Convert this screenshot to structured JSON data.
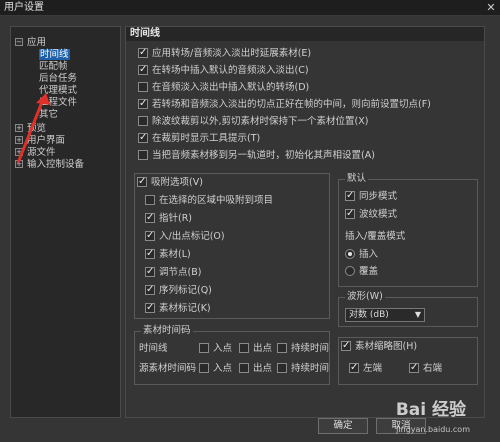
{
  "window": {
    "title": "用户设置",
    "close_glyph": "✕"
  },
  "tree": {
    "items": [
      {
        "label": "应用",
        "expander": "−",
        "level": 0
      },
      {
        "label": "时间线",
        "level": 1,
        "selected": true
      },
      {
        "label": "匹配帧",
        "level": 1
      },
      {
        "label": "后台任务",
        "level": 1
      },
      {
        "label": "代理模式",
        "level": 1
      },
      {
        "label": "工程文件",
        "level": 1
      },
      {
        "label": "其它",
        "level": 1
      },
      {
        "label": "预览",
        "expander": "+",
        "level": 0
      },
      {
        "label": "用户界面",
        "expander": "+",
        "level": 0
      },
      {
        "label": "源文件",
        "expander": "+",
        "level": 0
      },
      {
        "label": "输入控制设备",
        "expander": "+",
        "level": 0
      }
    ]
  },
  "panel": {
    "title": "时间线",
    "options": [
      {
        "label": "应用转场/音频淡入淡出时延展素材(E)",
        "checked": true
      },
      {
        "label": "在转场中插入默认的音频淡入淡出(C)",
        "checked": true
      },
      {
        "label": "在音频淡入淡出中插入默认的转场(D)",
        "checked": false
      },
      {
        "label": "若转场和音频淡入淡出的切点正好在帧的中间，则向前设置切点(F)",
        "checked": true
      },
      {
        "label": "除波纹裁剪以外,剪切素材时保持下一个素材位置(X)",
        "checked": false
      },
      {
        "label": "在裁剪时显示工具提示(T)",
        "checked": true
      },
      {
        "label": "当把音频素材移到另一轨道时，初始化其声相设置(A)",
        "checked": false
      }
    ],
    "snap": {
      "title": "吸附选项(V)",
      "checked": true,
      "items": [
        {
          "label": "在选择的区域中吸附到项目",
          "checked": false
        },
        {
          "label": "指针(R)",
          "checked": true
        },
        {
          "label": "入/出点标记(O)",
          "checked": true
        },
        {
          "label": "素材(L)",
          "checked": true
        },
        {
          "label": "调节点(B)",
          "checked": true
        },
        {
          "label": "序列标记(Q)",
          "checked": true
        },
        {
          "label": "素材标记(K)",
          "checked": true
        }
      ]
    },
    "default": {
      "title": "默认",
      "items": [
        {
          "label": "同步模式",
          "checked": true
        },
        {
          "label": "波纹模式",
          "checked": true
        }
      ],
      "insert_title": "插入/覆盖模式",
      "radios": [
        {
          "label": "插入",
          "checked": true
        },
        {
          "label": "覆盖",
          "checked": false
        }
      ]
    },
    "waveform": {
      "title": "波形(W)",
      "value": "对数 (dB)",
      "caret": "▼"
    },
    "timecode": {
      "title": "素材时间码",
      "rows": [
        {
          "label": "时间线",
          "cols": [
            "入点",
            "出点",
            "持续时间"
          ]
        },
        {
          "label": "源素材时间码",
          "cols": [
            "入点",
            "出点",
            "持续时间"
          ]
        }
      ]
    },
    "thumbnail": {
      "title": "素材缩略图(H)",
      "checked": true,
      "items": [
        {
          "label": "左端",
          "checked": true
        },
        {
          "label": "右端",
          "checked": true
        }
      ]
    }
  },
  "buttons": {
    "ok": "确定",
    "cancel": "取消"
  },
  "watermark": {
    "text": "Bai 经验",
    "sub": "jingyan.baidu.com"
  },
  "colors": {
    "selection": "#1d5fa8",
    "arrow": "#e0302a",
    "background": "#353535"
  }
}
